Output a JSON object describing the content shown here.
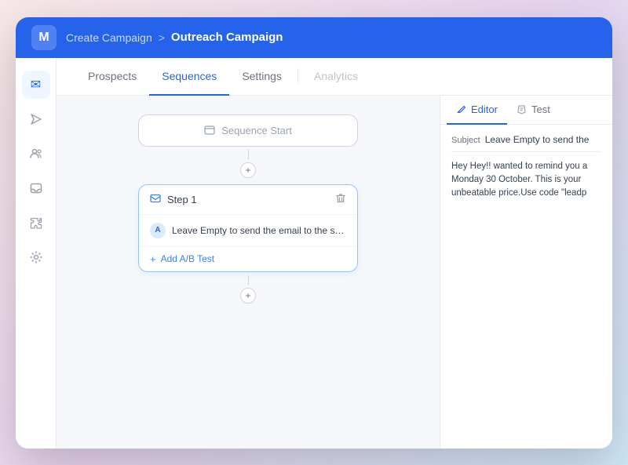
{
  "window": {
    "title": "Outreach Campaign"
  },
  "topbar": {
    "logo": "M",
    "breadcrumb_prev": "Create Campaign",
    "breadcrumb_separator": ">",
    "breadcrumb_current": "Outreach Campaign"
  },
  "sidebar": {
    "icons": [
      {
        "id": "envelope",
        "symbol": "✉",
        "active": true
      },
      {
        "id": "send",
        "symbol": "➤",
        "active": false
      },
      {
        "id": "users",
        "symbol": "👥",
        "active": false
      },
      {
        "id": "inbox",
        "symbol": "📥",
        "active": false
      },
      {
        "id": "puzzle",
        "symbol": "🧩",
        "active": false
      },
      {
        "id": "settings",
        "symbol": "⚙",
        "active": false
      }
    ]
  },
  "tabs": [
    {
      "id": "prospects",
      "label": "Prospects",
      "active": false
    },
    {
      "id": "sequences",
      "label": "Sequences",
      "active": true
    },
    {
      "id": "settings",
      "label": "Settings",
      "active": false
    },
    {
      "id": "analytics",
      "label": "Analytics",
      "active": false
    }
  ],
  "canvas": {
    "sequence_start_label": "Sequence Start",
    "step": {
      "title": "Step 1",
      "variant_label": "Leave Empty to send the email to the sa...",
      "variant_badge": "A",
      "add_ab_label": "Add A/B Test"
    }
  },
  "right_panel": {
    "tabs": [
      {
        "id": "editor",
        "label": "Editor",
        "active": true
      },
      {
        "id": "test",
        "label": "Test",
        "active": false
      }
    ],
    "subject_label": "Subject",
    "subject_value": "Leave Empty to send the",
    "body_text": "Hey Hey!! wanted to remind you a Monday 30 October. This is your unbeatable price.Use code \"leadp"
  }
}
